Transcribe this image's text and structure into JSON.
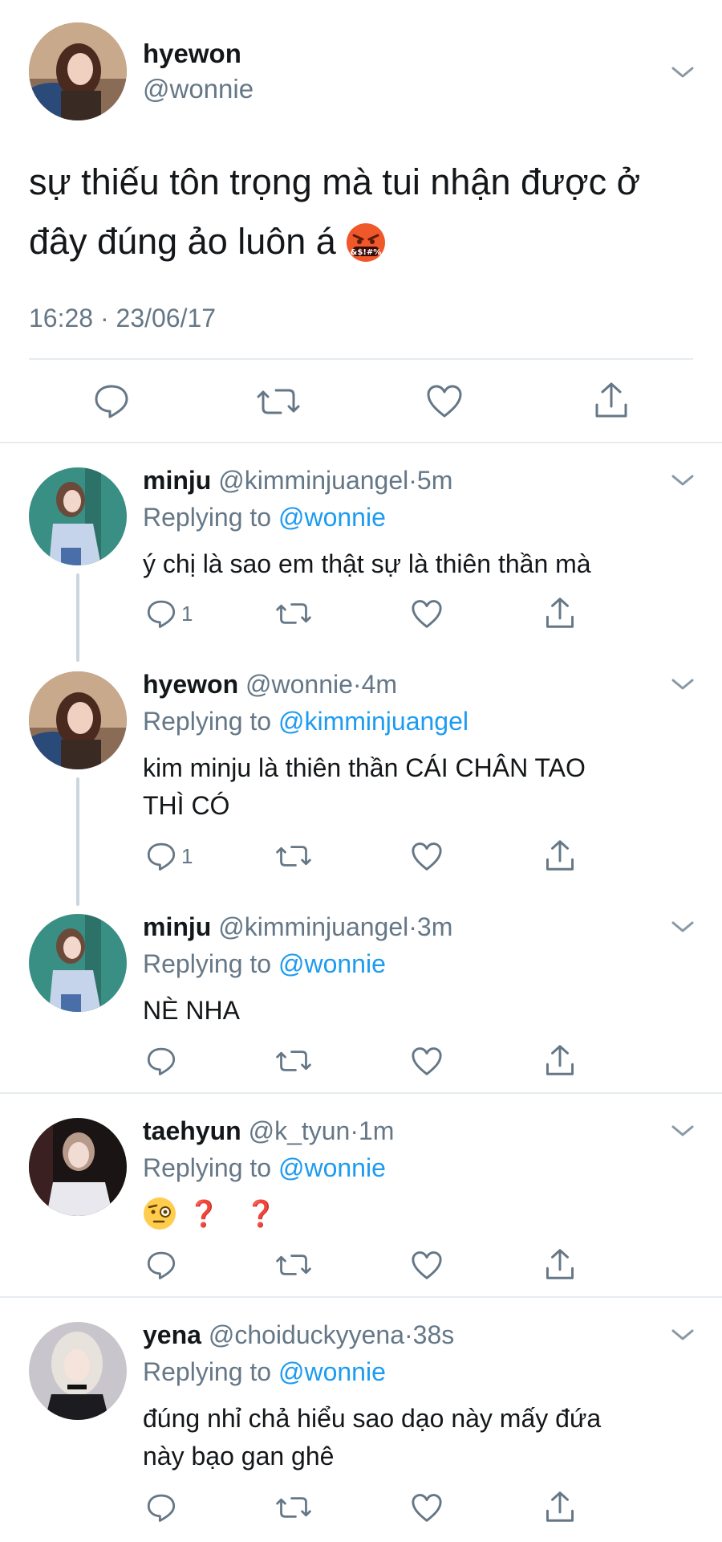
{
  "main_tweet": {
    "display_name": "hyewon",
    "handle": "@wonnie",
    "text": "sự thiếu tôn trọng mà tui nhận được ở đây đúng ảo luôn á",
    "timestamp": "16:28 · 23/06/17",
    "emoji_icon": "face-with-symbols-on-mouth"
  },
  "replies": [
    {
      "display_name": "minju",
      "handle": "@kimminjuangel",
      "sep": "·",
      "time": "5m",
      "replying_prefix": "Replying to",
      "replying_to": "@wonnie",
      "text": "ý chị là sao em thật sự là thiên thần mà",
      "reply_count": "1"
    },
    {
      "display_name": "hyewon",
      "handle": "@wonnie",
      "sep": "·",
      "time": "4m",
      "replying_prefix": "Replying to",
      "replying_to": "@kimminjuangel",
      "text_line1": "kim minju là thiên thần CÁI CHÂN TAO",
      "text_line2": "THÌ CÓ",
      "reply_count": "1"
    },
    {
      "display_name": "minju",
      "handle": "@kimminjuangel",
      "sep": "·",
      "time": "3m",
      "replying_prefix": "Replying to",
      "replying_to": "@wonnie",
      "text": "NÈ NHA",
      "reply_count": ""
    },
    {
      "display_name": "taehyun",
      "handle": "@k_tyun",
      "sep": "·",
      "time": "1m",
      "replying_prefix": "Replying to",
      "replying_to": "@wonnie",
      "text": "❓ ❓",
      "emoji_icon": "face-with-monocle",
      "reply_count": ""
    },
    {
      "display_name": "yena",
      "handle": "@choiduckyyena",
      "sep": "·",
      "time": "38s",
      "replying_prefix": "Replying to",
      "replying_to": "@wonnie",
      "text_line1": "đúng nhỉ chả hiểu sao dạo này mấy đứa",
      "text_line2": "này bạo gan ghê",
      "reply_count": ""
    }
  ],
  "colors": {
    "link": "#1d9bf0",
    "secondary_text": "#657786",
    "divider": "#e6ecf0",
    "thread_line": "#ccd6dd"
  }
}
